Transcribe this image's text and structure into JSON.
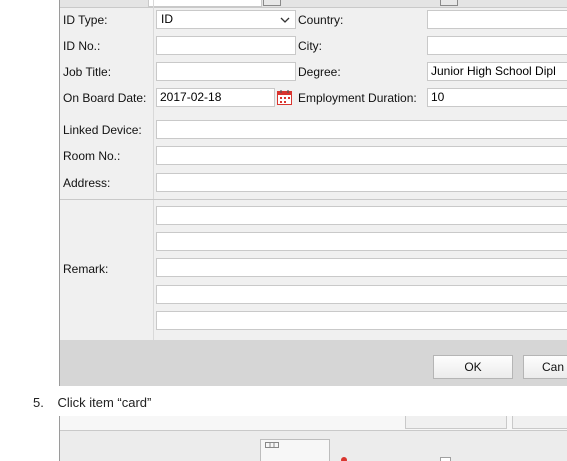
{
  "form": {
    "rows": [
      {
        "left_label": "ID Type:",
        "left_value": "ID",
        "right_label": "Country:",
        "right_value": ""
      },
      {
        "left_label": "ID No.:",
        "left_value": "",
        "right_label": "City:",
        "right_value": ""
      },
      {
        "left_label": "Job Title:",
        "left_value": "",
        "right_label": "Degree:",
        "right_value": "Junior High School Dipl"
      },
      {
        "left_label": "On Board Date:",
        "left_value": "2017-02-18",
        "right_label": "Employment Duration:",
        "right_value": "10"
      }
    ],
    "linked_device_label": "Linked Device:",
    "room_no_label": "Room No.:",
    "address_label": "Address:",
    "remark_label": "Remark:"
  },
  "icons": {
    "dropdown": "chevron-down-icon",
    "calendar": "calendar-icon"
  },
  "buttons": {
    "ok": "OK",
    "cancel": "Can"
  },
  "instruction": {
    "step": "5.",
    "text": "Click item “card”"
  },
  "colors": {
    "dialog_bg": "#f0f0f0",
    "footer_bg": "#d6d6d6",
    "field_border": "#c9c9c9",
    "calendar_red": "#d9352f"
  }
}
